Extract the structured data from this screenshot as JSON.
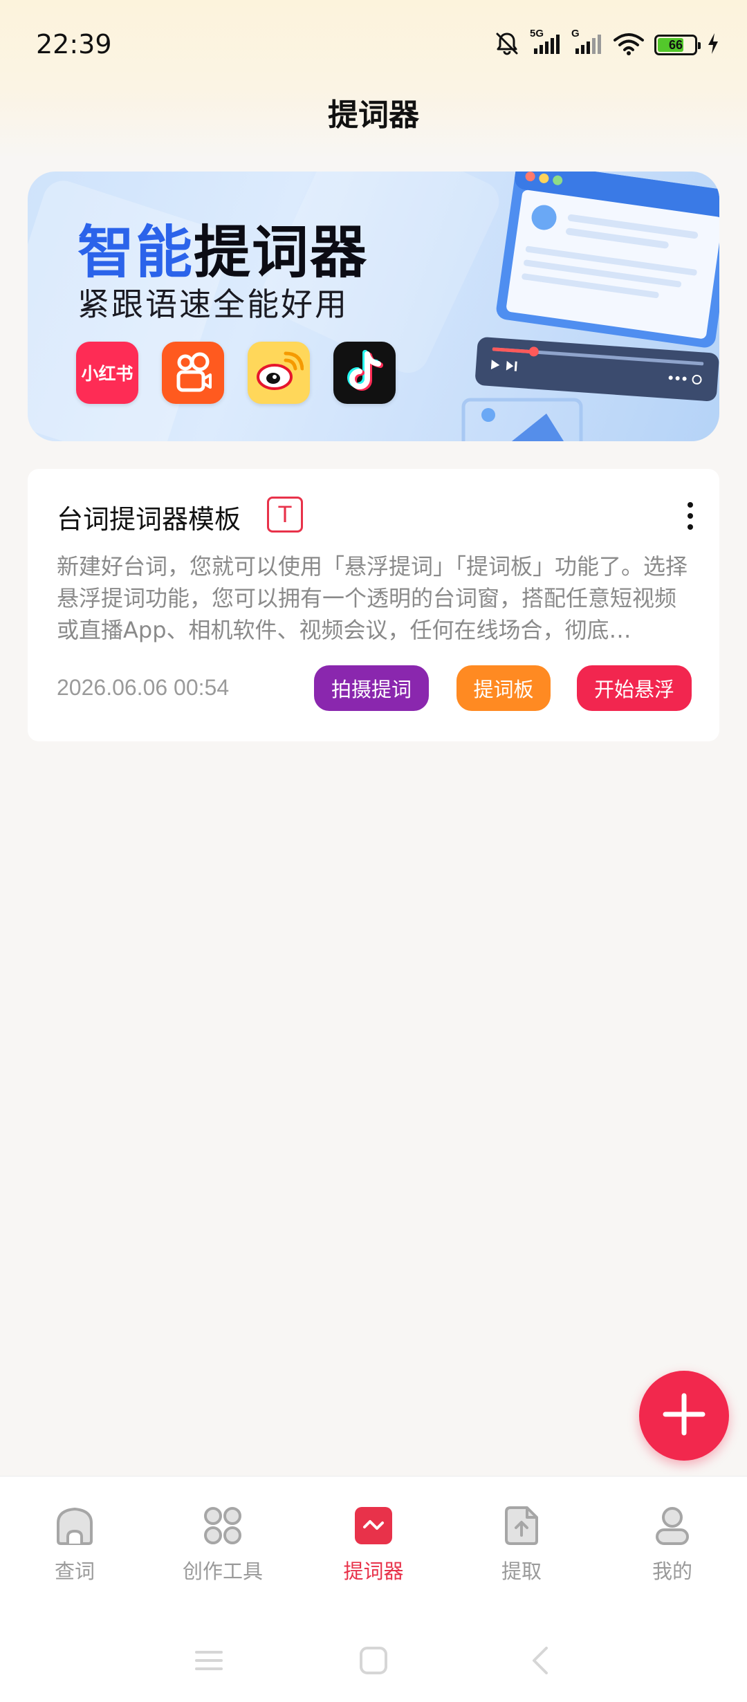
{
  "status_bar": {
    "time": "22:39",
    "network_1": "5G",
    "network_2": "G",
    "battery": "66",
    "icons": [
      "bell-muted-icon",
      "signal-icon",
      "signal-icon",
      "wifi-icon",
      "battery-icon",
      "charging-icon"
    ]
  },
  "page": {
    "title": "提词器"
  },
  "banner": {
    "title_highlight": "智能",
    "title_rest": "提词器",
    "subtitle": "紧跟语速全能好用",
    "apps": [
      {
        "name": "小红书",
        "icon": "xiaohongshu-icon"
      },
      {
        "name": "快手",
        "icon": "kuaishou-icon"
      },
      {
        "name": "微博",
        "icon": "weibo-icon"
      },
      {
        "name": "抖音",
        "icon": "douyin-icon"
      }
    ]
  },
  "template_card": {
    "title": "台词提词器模板",
    "badge": "T",
    "description": "新建好台词，您就可以使用「悬浮提词」「提词板」功能了。选择悬浮提词功能，您可以拥有一个透明的台词窗，搭配任意短视频或直播App、相机软件、视频会议，任何在线场合，彻底…",
    "date": "2026.06.06 00:54",
    "buttons": {
      "shoot": "拍摄提词",
      "board": "提词板",
      "float": "开始悬浮"
    },
    "colors": {
      "shoot": "#8a27ae",
      "board": "#ff8a22",
      "float": "#f2264f"
    }
  },
  "fab": {
    "icon": "plus-icon",
    "color": "#f2284d"
  },
  "bottom_nav": {
    "active_color": "#e8324a",
    "items": [
      {
        "label": "查词",
        "icon": "home-icon",
        "active": false
      },
      {
        "label": "创作工具",
        "icon": "grid-icon",
        "active": false
      },
      {
        "label": "提词器",
        "icon": "teleprompter-icon",
        "active": true
      },
      {
        "label": "提取",
        "icon": "extract-icon",
        "active": false
      },
      {
        "label": "我的",
        "icon": "profile-icon",
        "active": false
      }
    ]
  },
  "system_nav": {
    "icons": [
      "menu-icon",
      "home-square-icon",
      "back-icon"
    ]
  }
}
